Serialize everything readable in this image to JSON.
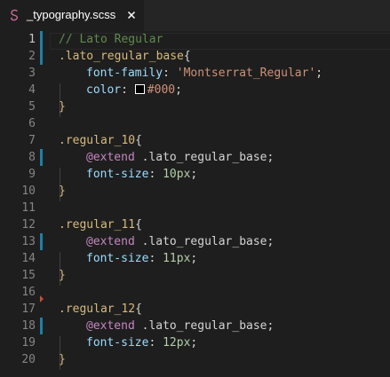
{
  "tab": {
    "filename": "_typography.scss",
    "icon": "sass-icon",
    "close_icon": "close-icon"
  },
  "colors": {
    "background": "#1e1e1e",
    "tabbar": "#252526",
    "comment": "#608b4e",
    "selector": "#d7ba7d",
    "property": "#9cdcfe",
    "string": "#ce9178",
    "number": "#b5cea8",
    "keyword": "#c586c0",
    "git_modified": "#1b81a8",
    "git_deleted": "#c74e39"
  },
  "editor": {
    "line_numbers": [
      "1",
      "2",
      "3",
      "4",
      "5",
      "6",
      "7",
      "8",
      "9",
      "10",
      "11",
      "12",
      "13",
      "14",
      "15",
      "16",
      "17",
      "18",
      "19",
      "20"
    ],
    "active_line": "1",
    "lines": {
      "l1": {
        "comment": "// Lato Regular"
      },
      "l2": {
        "selector": ".lato_regular_base",
        "brace": "{"
      },
      "l3": {
        "prop": "font-family",
        "sep": ": ",
        "value": "'Montserrat_Regular'",
        "end": ";"
      },
      "l4": {
        "prop": "color",
        "sep": ": ",
        "value": "#000",
        "end": ";"
      },
      "l5": {
        "brace": "}"
      },
      "l7": {
        "selector": ".regular_10",
        "brace": "{"
      },
      "l8": {
        "keyword": "@extend",
        "value": " .lato_regular_base;"
      },
      "l9": {
        "prop": "font-size",
        "sep": ": ",
        "value": "10px",
        "end": ";"
      },
      "l10": {
        "brace": "}"
      },
      "l12": {
        "selector": ".regular_11",
        "brace": "{"
      },
      "l13": {
        "keyword": "@extend",
        "value": " .lato_regular_base;"
      },
      "l14": {
        "prop": "font-size",
        "sep": ": ",
        "value": "11px",
        "end": ";"
      },
      "l15": {
        "brace": "}"
      },
      "l17": {
        "selector": ".regular_12",
        "brace": "{"
      },
      "l18": {
        "keyword": "@extend",
        "value": " .lato_regular_base;"
      },
      "l19": {
        "prop": "font-size",
        "sep": ": ",
        "value": "12px",
        "end": ";"
      },
      "l20": {
        "brace": "}"
      }
    }
  }
}
